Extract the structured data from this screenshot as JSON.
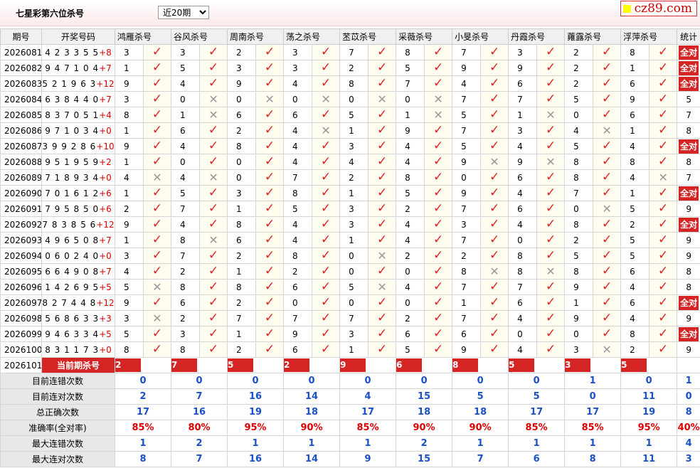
{
  "page": {
    "title": "七星彩第六位杀号",
    "period_select": "近20期",
    "logo": "cz89.com"
  },
  "header": {
    "period": "期号",
    "numbers": "开奖号码",
    "stat": "统计"
  },
  "experts": [
    "鸿雁杀号",
    "谷风杀号",
    "周南杀号",
    "荡之杀号",
    "苤苡杀号",
    "采薇杀号",
    "小旻杀号",
    "丹霞杀号",
    "蕹露杀号",
    "浮萍杀号"
  ],
  "all_right_label": "全对",
  "rows": [
    {
      "p": "2026081",
      "n": "4 2 3 3 5 5",
      "s": "+8",
      "k": [
        "3",
        "3",
        "2",
        "3",
        "7",
        "8",
        "7",
        "3",
        "2",
        "8"
      ],
      "h": [
        1,
        1,
        1,
        1,
        1,
        1,
        1,
        1,
        1,
        1
      ],
      "t": "全对"
    },
    {
      "p": "2026082",
      "n": "9 4 7 1 0 4",
      "s": "+7",
      "k": [
        "1",
        "5",
        "3",
        "3",
        "2",
        "5",
        "9",
        "9",
        "2",
        "1"
      ],
      "h": [
        1,
        1,
        1,
        1,
        1,
        1,
        1,
        1,
        1,
        1
      ],
      "t": "全对"
    },
    {
      "p": "2026083",
      "n": "5 2 1 9 6 3",
      "s": "+12",
      "k": [
        "9",
        "4",
        "9",
        "4",
        "8",
        "7",
        "4",
        "6",
        "2",
        "6"
      ],
      "h": [
        1,
        1,
        1,
        1,
        1,
        1,
        1,
        1,
        1,
        1
      ],
      "t": "全对"
    },
    {
      "p": "2026084",
      "n": "6 3 8 4 4 0",
      "s": "+7",
      "k": [
        "3",
        "0",
        "0",
        "0",
        "0",
        "0",
        "7",
        "7",
        "5",
        "9"
      ],
      "h": [
        1,
        0,
        0,
        0,
        0,
        0,
        1,
        1,
        1,
        1
      ],
      "t": "5"
    },
    {
      "p": "2026085",
      "n": "8 3 7 0 5 1",
      "s": "+4",
      "k": [
        "8",
        "1",
        "6",
        "6",
        "5",
        "1",
        "5",
        "1",
        "0",
        "6"
      ],
      "h": [
        1,
        0,
        1,
        1,
        1,
        0,
        1,
        0,
        1,
        1
      ],
      "t": "7"
    },
    {
      "p": "2026086",
      "n": "9 7 1 0 3 4",
      "s": "+0",
      "k": [
        "1",
        "6",
        "2",
        "4",
        "1",
        "9",
        "7",
        "3",
        "4",
        "1"
      ],
      "h": [
        1,
        1,
        1,
        0,
        1,
        1,
        1,
        1,
        0,
        1
      ],
      "t": "8"
    },
    {
      "p": "2026087",
      "n": "3 9 9 2 8 6",
      "s": "+10",
      "k": [
        "9",
        "4",
        "8",
        "4",
        "3",
        "4",
        "5",
        "4",
        "5",
        "4"
      ],
      "h": [
        1,
        1,
        1,
        1,
        1,
        1,
        1,
        1,
        1,
        1
      ],
      "t": "全对"
    },
    {
      "p": "2026088",
      "n": "9 5 1 9 5 9",
      "s": "+2",
      "k": [
        "1",
        "0",
        "0",
        "4",
        "4",
        "4",
        "9",
        "9",
        "8",
        "8"
      ],
      "h": [
        1,
        1,
        1,
        1,
        1,
        1,
        0,
        0,
        1,
        1
      ],
      "t": "8"
    },
    {
      "p": "2026089",
      "n": "7 1 8 9 3 4",
      "s": "+0",
      "k": [
        "4",
        "4",
        "0",
        "7",
        "2",
        "8",
        "0",
        "6",
        "8",
        "4"
      ],
      "h": [
        0,
        0,
        1,
        1,
        1,
        1,
        1,
        1,
        1,
        0
      ],
      "t": "7"
    },
    {
      "p": "2026090",
      "n": "7 0 1 6 1 2",
      "s": "+6",
      "k": [
        "1",
        "5",
        "3",
        "8",
        "1",
        "5",
        "9",
        "4",
        "7",
        "1"
      ],
      "h": [
        1,
        1,
        1,
        1,
        1,
        1,
        1,
        1,
        1,
        1
      ],
      "t": "全对"
    },
    {
      "p": "2026091",
      "n": "7 9 5 8 5 0",
      "s": "+6",
      "k": [
        "2",
        "7",
        "1",
        "5",
        "3",
        "2",
        "7",
        "6",
        "0",
        "5"
      ],
      "h": [
        1,
        1,
        1,
        1,
        1,
        1,
        1,
        1,
        0,
        1
      ],
      "t": "9"
    },
    {
      "p": "2026092",
      "n": "7 8 3 8 5 6",
      "s": "+12",
      "k": [
        "9",
        "4",
        "8",
        "4",
        "3",
        "4",
        "3",
        "4",
        "8",
        "2"
      ],
      "h": [
        1,
        1,
        1,
        1,
        1,
        1,
        1,
        1,
        1,
        1
      ],
      "t": "全对"
    },
    {
      "p": "2026093",
      "n": "4 9 6 5 0 8",
      "s": "+7",
      "k": [
        "1",
        "8",
        "6",
        "4",
        "1",
        "4",
        "7",
        "0",
        "2",
        "5"
      ],
      "h": [
        1,
        0,
        1,
        1,
        1,
        1,
        1,
        1,
        1,
        1
      ],
      "t": "9"
    },
    {
      "p": "2026094",
      "n": "0 6 0 2 4 0",
      "s": "+0",
      "k": [
        "3",
        "7",
        "2",
        "8",
        "0",
        "2",
        "2",
        "8",
        "5",
        "5"
      ],
      "h": [
        1,
        1,
        1,
        1,
        0,
        1,
        1,
        1,
        1,
        1
      ],
      "t": "9"
    },
    {
      "p": "2026095",
      "n": "6 6 4 9 0 8",
      "s": "+7",
      "k": [
        "4",
        "2",
        "1",
        "2",
        "0",
        "0",
        "8",
        "8",
        "8",
        "6"
      ],
      "h": [
        1,
        1,
        1,
        1,
        1,
        1,
        0,
        0,
        1,
        1
      ],
      "t": "8"
    },
    {
      "p": "2026096",
      "n": "1 4 2 6 9 5",
      "s": "+5",
      "k": [
        "5",
        "8",
        "8",
        "6",
        "5",
        "4",
        "7",
        "7",
        "9",
        "4"
      ],
      "h": [
        0,
        1,
        1,
        1,
        0,
        1,
        1,
        1,
        1,
        1
      ],
      "t": "8"
    },
    {
      "p": "2026097",
      "n": "8 2 7 4 4 8",
      "s": "+12",
      "k": [
        "9",
        "6",
        "2",
        "0",
        "0",
        "0",
        "1",
        "6",
        "1",
        "6"
      ],
      "h": [
        1,
        1,
        1,
        1,
        1,
        1,
        1,
        1,
        1,
        1
      ],
      "t": "全对"
    },
    {
      "p": "2026098",
      "n": "5 6 8 6 3 3",
      "s": "+3",
      "k": [
        "3",
        "2",
        "7",
        "7",
        "7",
        "2",
        "7",
        "4",
        "9",
        "4"
      ],
      "h": [
        0,
        1,
        1,
        1,
        1,
        1,
        1,
        1,
        1,
        1
      ],
      "t": "9"
    },
    {
      "p": "2026099",
      "n": "9 4 6 3 3 4",
      "s": "+5",
      "k": [
        "5",
        "3",
        "1",
        "9",
        "3",
        "6",
        "6",
        "0",
        "0",
        "8"
      ],
      "h": [
        1,
        1,
        1,
        1,
        1,
        1,
        1,
        1,
        1,
        1
      ],
      "t": "全对"
    },
    {
      "p": "2026100",
      "n": "8 3 1 1 7 3",
      "s": "+0",
      "k": [
        "8",
        "8",
        "2",
        "6",
        "1",
        "5",
        "9",
        "4",
        "3",
        "2"
      ],
      "h": [
        1,
        1,
        1,
        1,
        1,
        1,
        1,
        1,
        0,
        1
      ],
      "t": "9"
    }
  ],
  "current": {
    "period": "2026101",
    "label": "当前期杀号",
    "kills": [
      "2",
      "7",
      "5",
      "2",
      "9",
      "6",
      "8",
      "5",
      "3",
      "5"
    ]
  },
  "stats": [
    {
      "label": "目前连错次数",
      "vals": [
        "0",
        "0",
        "0",
        "0",
        "0",
        "0",
        "0",
        "0",
        "1",
        "0"
      ],
      "total": "1",
      "cls": "blue"
    },
    {
      "label": "目前连对次数",
      "vals": [
        "2",
        "7",
        "16",
        "14",
        "4",
        "15",
        "5",
        "5",
        "0",
        "11"
      ],
      "total": "0",
      "cls": "blue"
    },
    {
      "label": "总正确次数",
      "vals": [
        "17",
        "16",
        "19",
        "18",
        "17",
        "18",
        "18",
        "17",
        "17",
        "19"
      ],
      "total": "8",
      "cls": "blue"
    },
    {
      "label": "准确率(全对率)",
      "vals": [
        "85%",
        "80%",
        "95%",
        "90%",
        "85%",
        "90%",
        "90%",
        "85%",
        "85%",
        "95%"
      ],
      "total": "40%",
      "cls": "red"
    },
    {
      "label": "最大连错次数",
      "vals": [
        "1",
        "2",
        "1",
        "1",
        "1",
        "2",
        "1",
        "1",
        "1",
        "1"
      ],
      "total": "4",
      "cls": "blue"
    },
    {
      "label": "最大连对次数",
      "vals": [
        "8",
        "7",
        "16",
        "14",
        "9",
        "15",
        "7",
        "6",
        "8",
        "11"
      ],
      "total": "3",
      "cls": "blue"
    }
  ],
  "colors": {
    "accent_red": "#d42424",
    "check_red": "#e02020",
    "stat_blue": "#1a50c8"
  },
  "icons": {
    "right": "check-icon",
    "wrong": "cross-icon"
  }
}
